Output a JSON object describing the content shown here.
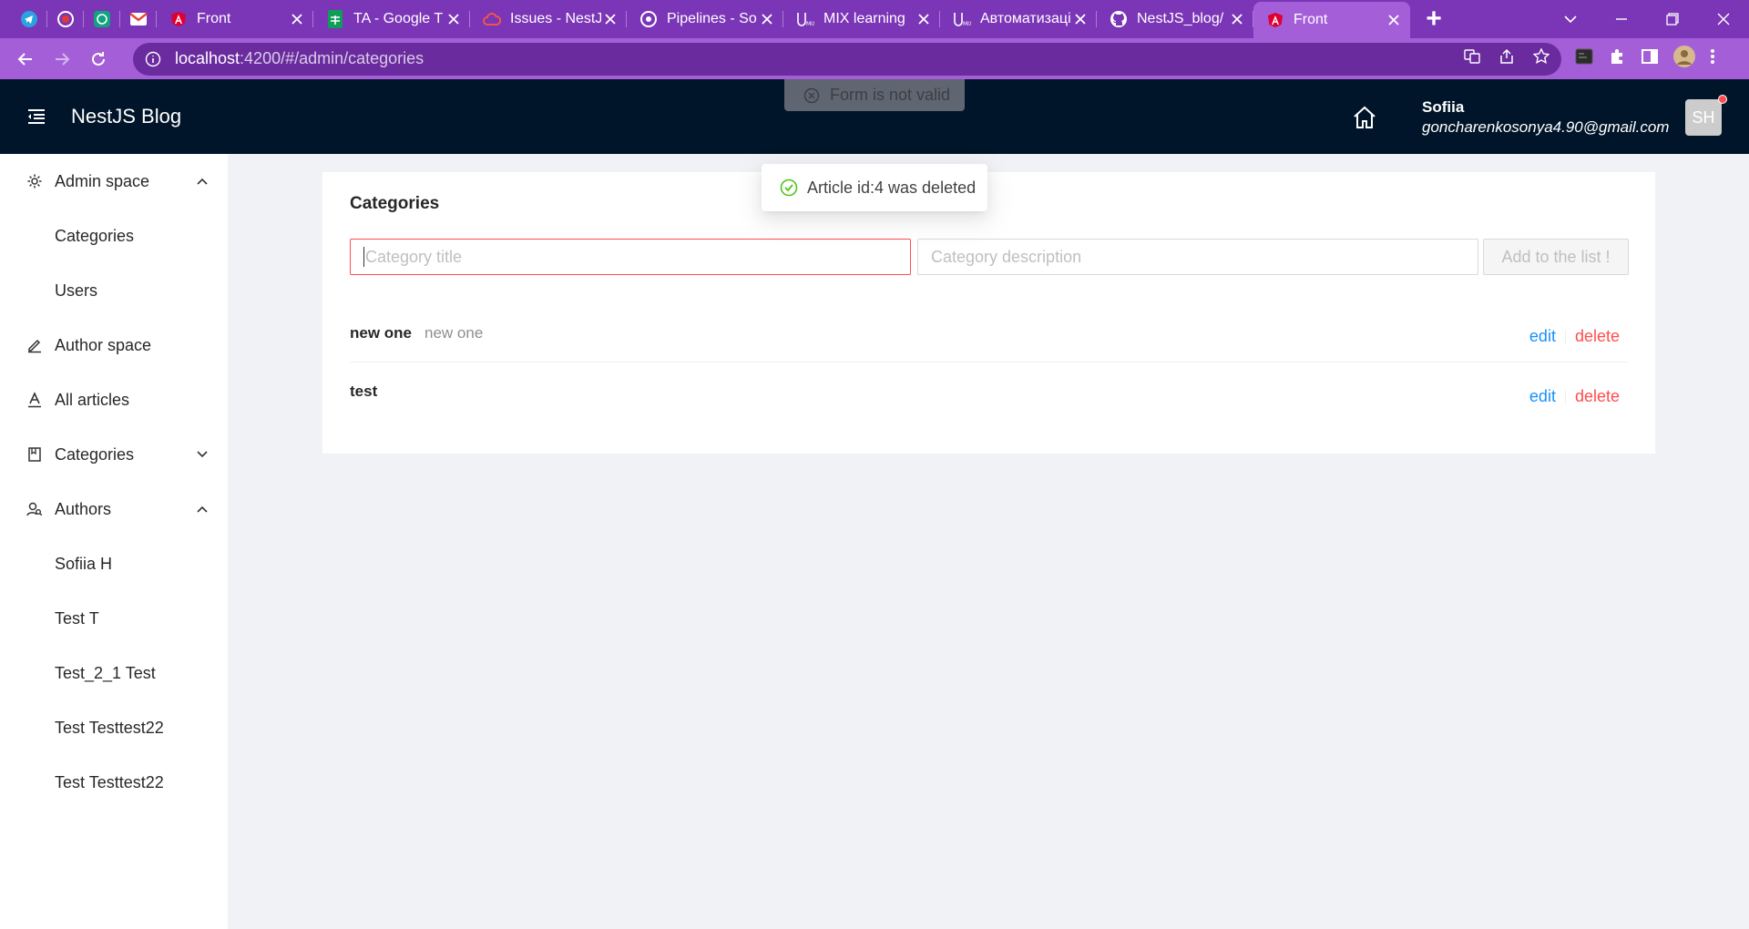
{
  "browser": {
    "pinned_tabs": [
      {
        "icon": "telegram-icon"
      },
      {
        "icon": "record-icon"
      },
      {
        "icon": "openai-icon"
      },
      {
        "icon": "gmail-icon"
      }
    ],
    "tabs": [
      {
        "label": "Front",
        "icon": "angular-icon",
        "active": false
      },
      {
        "label": "TA - Google T",
        "icon": "google-sheets-icon",
        "active": false
      },
      {
        "label": "Issues - NestJ",
        "icon": "cloud-icon",
        "active": false
      },
      {
        "label": "Pipelines - So",
        "icon": "pipelines-icon",
        "active": false
      },
      {
        "label": "MIX learning",
        "icon": "mix-icon",
        "active": false
      },
      {
        "label": "Автоматизаці",
        "icon": "mix-icon",
        "active": false
      },
      {
        "label": "NestJS_blog/",
        "icon": "github-icon",
        "active": false
      },
      {
        "label": "Front",
        "icon": "angular-icon",
        "active": true
      }
    ],
    "url_host": "localhost",
    "url_rest": ":4200/#/admin/categories",
    "accent": "#7b35b7"
  },
  "header": {
    "brand": "NestJS Blog",
    "user_name": "Sofiia",
    "user_email": "goncharenkosonya4.90@gmail.com",
    "avatar_initials": "SH"
  },
  "sidebar": {
    "items": [
      {
        "label": "Admin space",
        "icon": "gear-icon",
        "arrow": "up"
      },
      {
        "label": "Categories",
        "sub": true
      },
      {
        "label": "Users",
        "sub": true
      },
      {
        "label": "Author space",
        "icon": "edit-icon"
      },
      {
        "label": "All articles",
        "icon": "font-icon"
      },
      {
        "label": "Categories",
        "icon": "book-icon",
        "arrow": "down"
      },
      {
        "label": "Authors",
        "icon": "user-search-icon",
        "arrow": "up"
      },
      {
        "label": "Sofiia H",
        "sub": true
      },
      {
        "label": "Test T",
        "sub": true
      },
      {
        "label": "Test_2_1 Test",
        "sub": true
      },
      {
        "label": "Test Testtest22",
        "sub": true
      },
      {
        "label": "Test Testtest22",
        "sub": true
      }
    ]
  },
  "main": {
    "title": "Categories",
    "title_placeholder": "Category title",
    "description_placeholder": "Category description",
    "add_label": "Add to the list !",
    "rows": [
      {
        "title": "new one",
        "description": "new one",
        "edit": "edit",
        "delete": "delete"
      },
      {
        "title": "test",
        "description": "",
        "edit": "edit",
        "delete": "delete"
      }
    ]
  },
  "toasts": {
    "error": "Form is not valid",
    "success": "Article id:4 was deleted"
  }
}
